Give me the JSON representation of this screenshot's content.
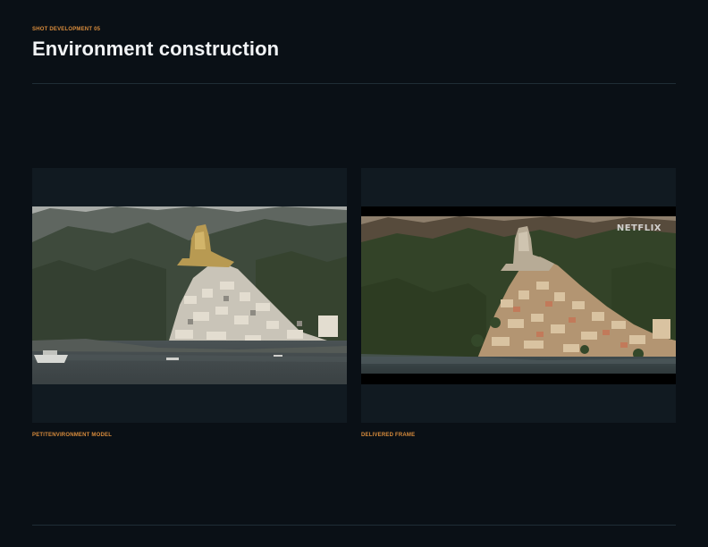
{
  "header": {
    "eyebrow": "SHOT DEVELOPMENT 05",
    "title": "Environment construction"
  },
  "panels": [
    {
      "caption": "PETITENVIRONMENT MODEL",
      "image": "aerial-coastal-town-model"
    },
    {
      "caption": "DELIVERED FRAME",
      "image": "aerial-coastal-town-final",
      "watermark": "NETFLIX"
    }
  ],
  "colors": {
    "background": "#0a1016",
    "panel": "#111a21",
    "accent": "#d98c3c",
    "rule": "#1f2d36",
    "title": "#f2f4f6"
  }
}
